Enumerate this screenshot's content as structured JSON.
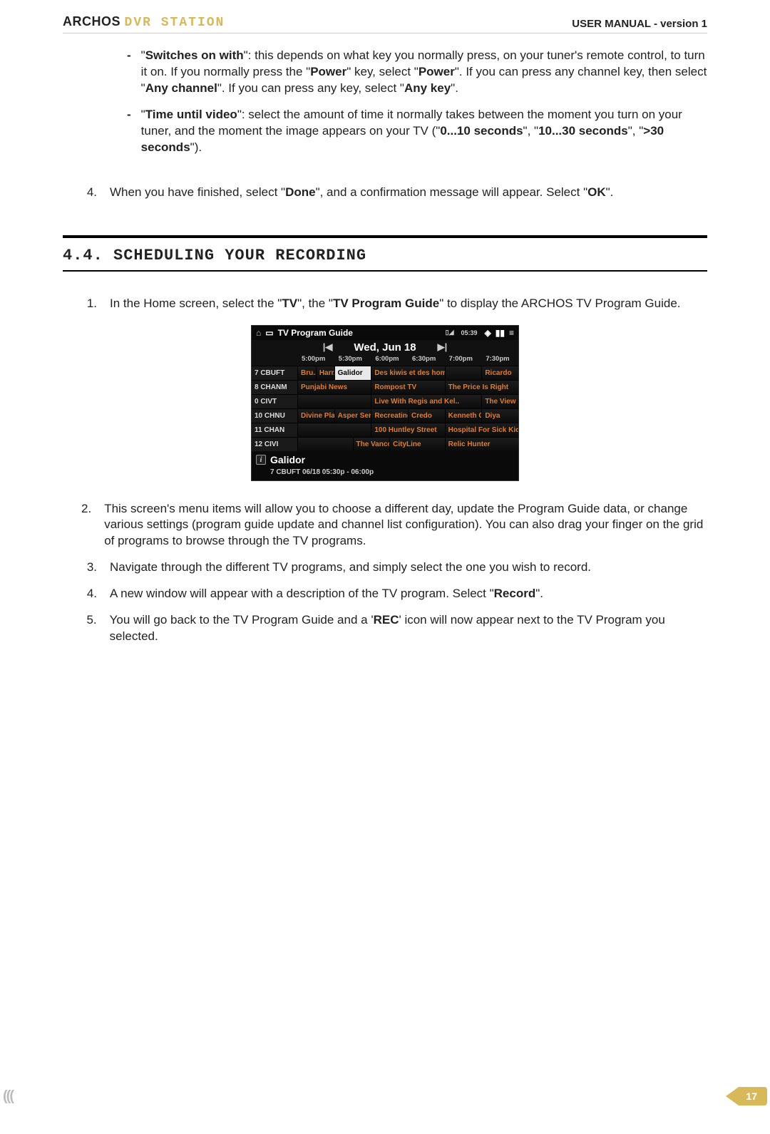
{
  "header": {
    "brand": "ARCHOS",
    "product": "DVR STATION",
    "manual": "USER MANUAL - version 1"
  },
  "bullets": [
    {
      "label": "Switches on with",
      "text": ": this depends on what key you normally press, on your tuner's remote control, to turn it on. If you normally press the \"",
      "b1": "Power",
      "mid1": "\" key, select \"",
      "b2": "Power",
      "mid2": "\". If you can press any channel key, then select \"",
      "b3": "Any channel",
      "mid3": "\". If you can press any key, select \"",
      "b4": "Any key",
      "end": "\"."
    },
    {
      "label": "Time until video",
      "text": ": select the amount of time it normally takes between the moment you turn on your tuner, and the moment the image appears on your TV (\"",
      "b1": "0...10 seconds",
      "mid1": "\", \"",
      "b2": "10...30 seconds",
      "mid2": "\", \"",
      "b3": ">30 seconds",
      "end": "\")."
    }
  ],
  "step4": {
    "num": "4.",
    "pre": "When you have finished, select \"",
    "b1": "Done",
    "mid": "\", and a confirmation message will appear. Select \"",
    "b2": "OK",
    "end": "\"."
  },
  "section": {
    "title": "4.4. SCHEDULING YOUR RECORDING"
  },
  "steps": [
    {
      "num": "1.",
      "pre": "In the Home screen, select the \"",
      "b1": "TV",
      "mid": "\", the \"",
      "b2": "TV Program Guide",
      "end": "\" to display the ARCHOS TV Program Guide."
    },
    {
      "num": "2.",
      "text": "This screen's menu items will allow you to choose a different day, update the Program Guide data, or change various settings (program guide update and channel list configuration). You can also drag your finger on the grid of programs to browse through the TV programs."
    },
    {
      "num": "3.",
      "text": "Navigate through the different TV programs, and simply select the one you wish to record."
    },
    {
      "num": "4.",
      "pre": "A new window will appear with a description of the TV program. Select \"",
      "b1": "Record",
      "end": "\"."
    },
    {
      "num": "5.",
      "pre": "You will go back to the TV Program Guide and a '",
      "b1": "REC",
      "end": "' icon will now appear next to the TV Program you selected."
    }
  ],
  "guide": {
    "title": "TV Program Guide",
    "status_time": "05:39",
    "date": "Wed, Jun 18",
    "times": [
      "5:00pm",
      "5:30pm",
      "6:00pm",
      "6:30pm",
      "7:00pm",
      "7:30pm"
    ],
    "channels": [
      "7 CBUFT",
      "8 CHANM",
      "0 CIVT",
      "10 CHNU",
      "11 CHAN",
      "12 CIVI"
    ],
    "rows": [
      [
        {
          "span": 1,
          "t": "Bru.."
        },
        {
          "span": 1,
          "t": "Harr.."
        },
        {
          "span": 2,
          "t": "Galidor",
          "sel": true
        },
        {
          "span": 4,
          "t": "Des kiwis et des hommes"
        },
        {
          "span": 2,
          "t": ""
        },
        {
          "span": 2,
          "t": "Ricardo"
        }
      ],
      [
        {
          "span": 4,
          "t": "Punjabi News"
        },
        {
          "span": 4,
          "t": "Rompost TV"
        },
        {
          "span": 4,
          "t": "The Price Is Right"
        }
      ],
      [
        {
          "span": 4,
          "t": ""
        },
        {
          "span": 6,
          "t": "Live With Regis and Kel.."
        },
        {
          "span": 2,
          "t": "The View"
        }
      ],
      [
        {
          "span": 2,
          "t": "Divine Plan"
        },
        {
          "span": 2,
          "t": "Asper Seri.."
        },
        {
          "span": 2,
          "t": "Recreating.."
        },
        {
          "span": 2,
          "t": "Credo"
        },
        {
          "span": 2,
          "t": "Kenneth C.."
        },
        {
          "span": 2,
          "t": "Diya"
        }
      ],
      [
        {
          "span": 4,
          "t": ""
        },
        {
          "span": 4,
          "t": "100 Huntley Street"
        },
        {
          "span": 4,
          "t": "Hospital For Sick Kids"
        }
      ],
      [
        {
          "span": 3,
          "t": ""
        },
        {
          "span": 2,
          "t": "The Vanco.."
        },
        {
          "span": 3,
          "t": "CityLine"
        },
        {
          "span": 4,
          "t": "Relic Hunter"
        }
      ]
    ],
    "detail_title": "Galidor",
    "detail_sub": "7 CBUFT   06/18 05:30p - 06:00p"
  },
  "footer": {
    "page": "17"
  }
}
